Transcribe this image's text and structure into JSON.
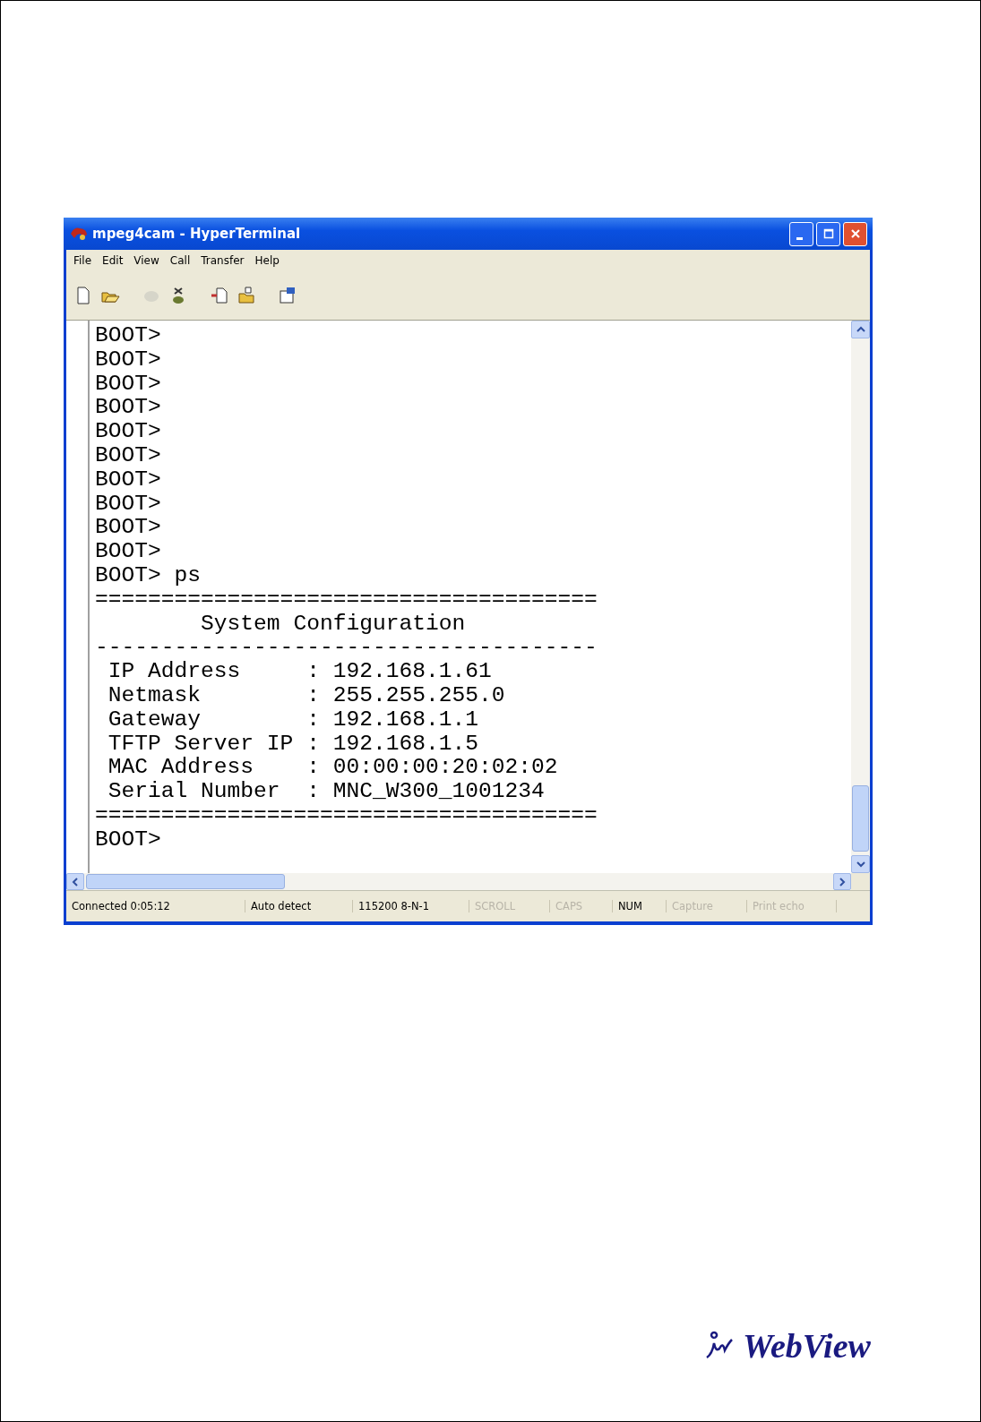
{
  "window": {
    "title": "mpeg4cam - HyperTerminal"
  },
  "menu": [
    "File",
    "Edit",
    "View",
    "Call",
    "Transfer",
    "Help"
  ],
  "toolbar": [
    {
      "kind": "new",
      "disabled": false
    },
    {
      "kind": "open",
      "disabled": false
    },
    {
      "kind": "call",
      "disabled": true
    },
    {
      "kind": "disconnect",
      "disabled": false
    },
    {
      "kind": "send",
      "disabled": false
    },
    {
      "kind": "receive",
      "disabled": false
    },
    {
      "kind": "properties",
      "disabled": false
    }
  ],
  "terminal": {
    "lines": [
      "BOOT>",
      "BOOT>",
      "BOOT>",
      "BOOT>",
      "BOOT>",
      "BOOT>",
      "BOOT>",
      "BOOT>",
      "BOOT>",
      "BOOT>",
      "BOOT> ps",
      "======================================",
      "        System Configuration",
      "--------------------------------------",
      " IP Address     : 192.168.1.61",
      " Netmask        : 255.255.255.0",
      " Gateway        : 192.168.1.1",
      " TFTP Server IP : 192.168.1.5",
      " MAC Address    : 00:00:00:20:02:02",
      " Serial Number  : MNC_W300_1001234",
      "======================================",
      "BOOT>"
    ]
  },
  "status_bar": [
    {
      "text": "Connected 0:05:12",
      "disabled": false
    },
    {
      "text": "Auto detect",
      "disabled": false
    },
    {
      "text": "115200 8-N-1",
      "disabled": false
    },
    {
      "text": "SCROLL",
      "disabled": true
    },
    {
      "text": "CAPS",
      "disabled": true
    },
    {
      "text": "NUM",
      "disabled": false
    },
    {
      "text": "Capture",
      "disabled": true
    },
    {
      "text": "Print echo",
      "disabled": true
    }
  ],
  "logo": {
    "text": "WebView"
  }
}
